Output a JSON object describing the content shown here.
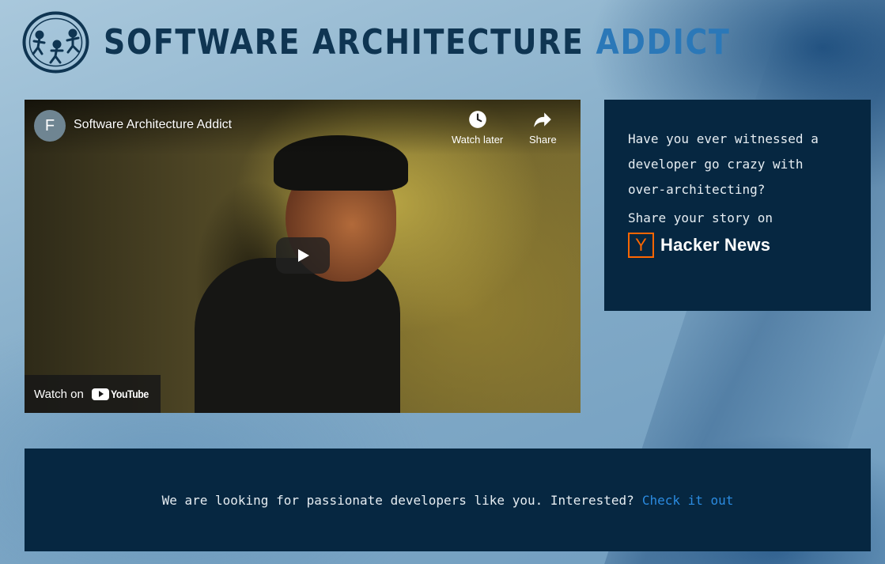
{
  "header": {
    "title_main": "Software Architecture",
    "title_accent": "Addict"
  },
  "video": {
    "channel_initial": "F",
    "title": "Software Architecture Addict",
    "watch_later_label": "Watch later",
    "share_label": "Share",
    "watch_on_label": "Watch on",
    "youtube_label": "YouTube"
  },
  "side_panel": {
    "question": "Have you ever witnessed a developer go crazy with over-architecting?",
    "share_prompt": "Share your story on",
    "hn_letter": "Y",
    "hn_name": "Hacker News"
  },
  "banner": {
    "text": "We are looking for passionate developers like you. Interested?",
    "link_label": "Check it out"
  },
  "colors": {
    "panel_bg": "#062741",
    "title_dark": "#0f3552",
    "title_accent": "#2b78b8",
    "link": "#2b8be0",
    "hn_orange": "#ff6600"
  }
}
